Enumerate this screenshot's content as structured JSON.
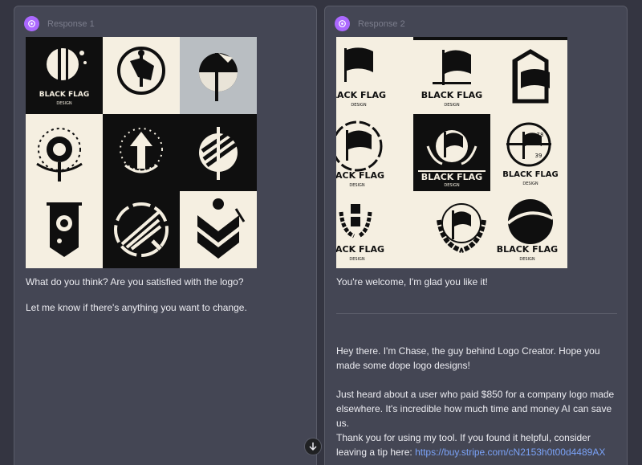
{
  "responses": [
    {
      "label": "Response 1",
      "message_1": "What do you think? Are you satisfied with the logo?",
      "message_2": "Let me know if there's anything you want to change.",
      "logo_text_line1": "BLACK FLAG",
      "logo_text_line2": "DESIGN"
    },
    {
      "label": "Response 2",
      "message_1": "You're welcome, I'm glad you like it!",
      "promo_1": "Hey there. I'm Chase, the guy behind Logo Creator. Hope you made some dope logo designs!",
      "promo_2": "Just heard about a user who paid $850 for a company logo made elsewhere. It's incredible how much time and money AI can save us.",
      "promo_3_prefix": "Thank you for using my tool. If you found it helpful, consider leaving a tip here: ",
      "promo_3_link": "https://buy.stripe.com/cN2153h0t00d4489AX",
      "logo_cells": [
        {
          "line1": "LACK FLAG",
          "line2": "DESIGN"
        },
        {
          "line1": "BLACK FLAG",
          "line2": "DESIGN"
        },
        {
          "line1": "",
          "line2": ""
        },
        {
          "line1": "LACK FLAG",
          "line2": "DESIGN"
        },
        {
          "line1": "BLACK FLAG",
          "line2": "DESIGN"
        },
        {
          "line1": "BLACK FLAG",
          "line2": "DESIGN",
          "extra1": "78",
          "extra2": "39"
        },
        {
          "line1": "LACK FLAG",
          "line2": "DESIGN"
        },
        {
          "line1": "",
          "line2": ""
        },
        {
          "line1": "BLACK FLAG",
          "line2": "DESIGN"
        }
      ]
    }
  ],
  "colors": {
    "background": "#343541",
    "panel": "#444654",
    "avatar": "#ab68ff",
    "link": "#7aa2f7",
    "cream": "#f5efe1",
    "black": "#0f0f0f"
  }
}
